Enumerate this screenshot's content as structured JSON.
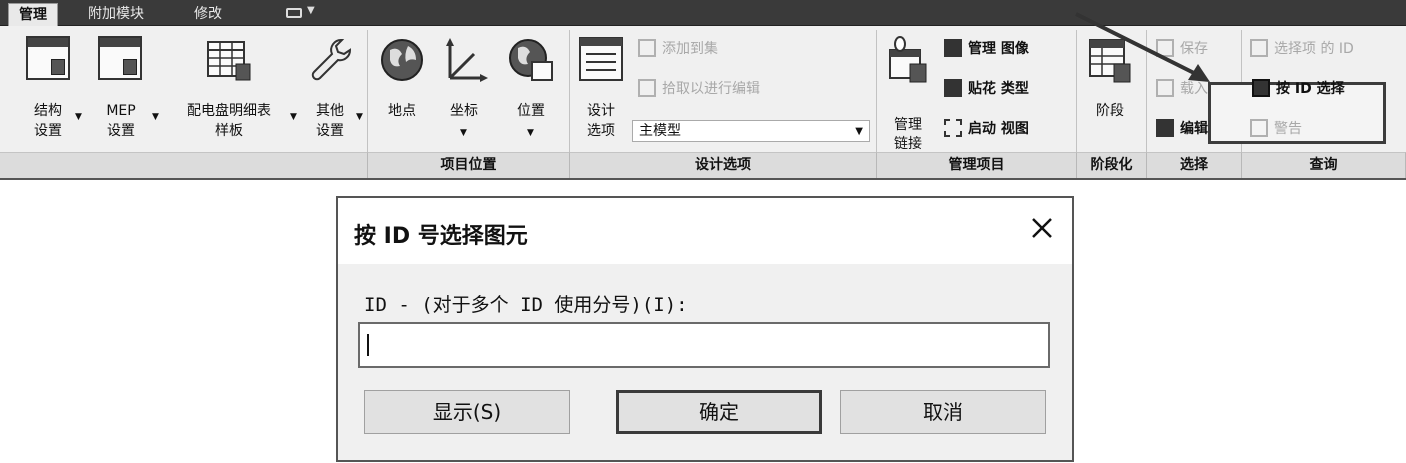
{
  "tabs": [
    {
      "label": "管理",
      "active": true
    },
    {
      "label": "附加模块",
      "active": false
    },
    {
      "label": "修改",
      "active": false
    }
  ],
  "ribbon": {
    "structure_settings": {
      "line1": "结构",
      "line2": "设置"
    },
    "mep_settings": {
      "line1": "MEP",
      "line2": "设置"
    },
    "panel_schedule_template": {
      "line1": "配电盘明细表",
      "line2": "样板"
    },
    "other_settings": {
      "line1": "其他",
      "line2": "设置"
    },
    "location": "地点",
    "coordinates": "坐标",
    "position": "位置",
    "design_options_btn": {
      "line1": "设计",
      "line2": "选项"
    },
    "add_to_set": "添加到集",
    "pick_to_edit": "拾取以进行编辑",
    "main_model": "主模型",
    "manage_links": {
      "line1": "管理",
      "line2": "链接"
    },
    "manage_images": "管理 图像",
    "decal_types": "贴花 类型",
    "starting_view": "启动 视图",
    "phases": "阶段",
    "save": "保存",
    "load": "载入",
    "edit": "编辑",
    "ids_of_selection": "选择项 的 ID",
    "select_by_id": "按 ID 选择",
    "warnings": "警告",
    "groups": {
      "project_location": "项目位置",
      "design_options": "设计选项",
      "manage_project": "管理项目",
      "phasing": "阶段化",
      "selection": "选择",
      "inquiry": "查询"
    }
  },
  "dialog": {
    "title": "按 ID 号选择图元",
    "close_glyph": "✕",
    "label": "ID - (对于多个 ID 使用分号)(I):",
    "input_value": "",
    "show_button": "显示(S)",
    "ok_button": "确定",
    "cancel_button": "取消"
  }
}
